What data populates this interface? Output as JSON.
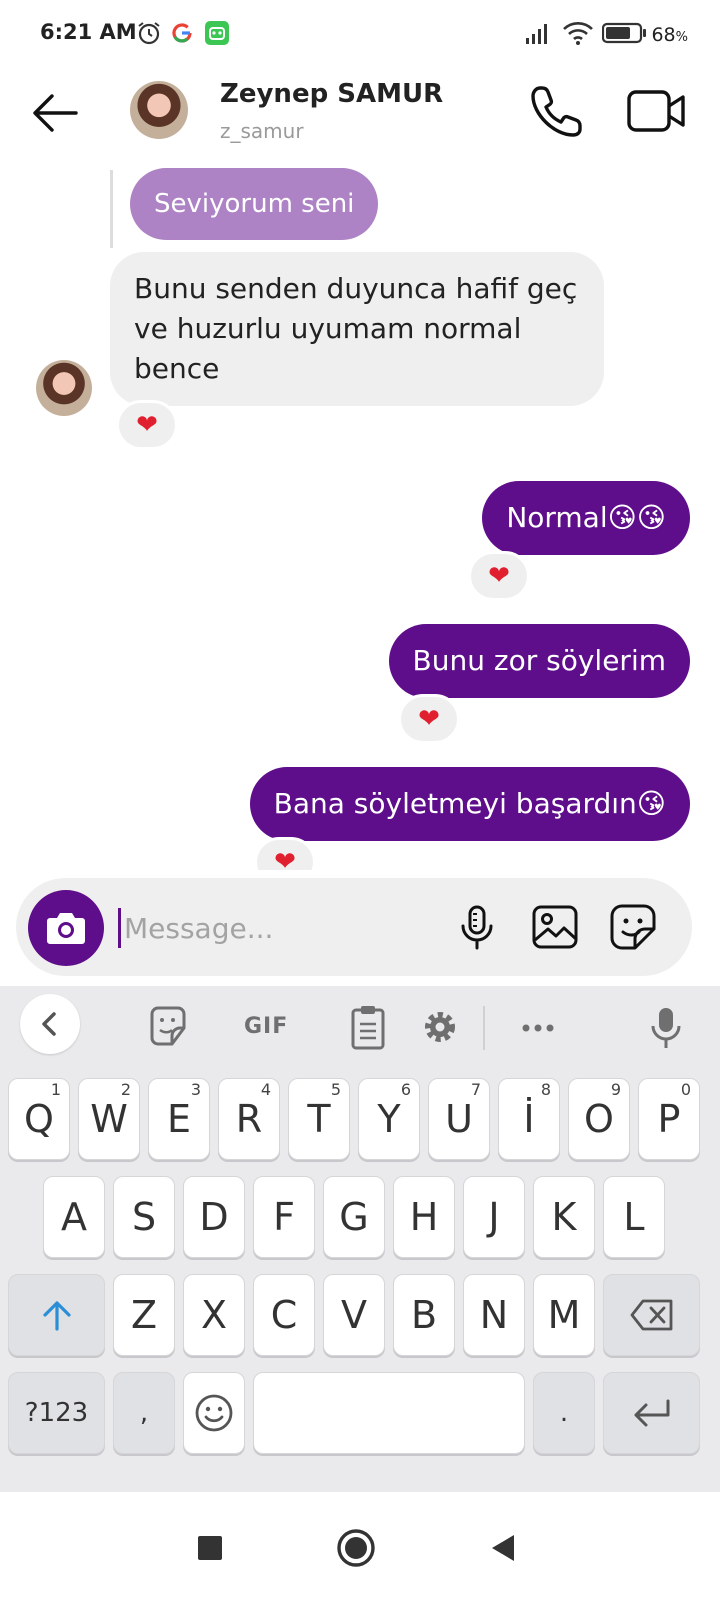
{
  "status_bar": {
    "time": "6:21 AM",
    "battery_percent": "68",
    "battery_suffix": "%",
    "icons": [
      "alarm-icon",
      "google-icon",
      "robot-app-icon",
      "signal-icon",
      "wifi-icon",
      "battery-icon"
    ]
  },
  "header": {
    "contact_name": "Zeynep SAMUR",
    "username": "z_samur",
    "icons": [
      "back-arrow-icon",
      "phone-icon",
      "video-camera-icon"
    ]
  },
  "messages": [
    {
      "type": "quoted",
      "text": "Seviyorum seni"
    },
    {
      "type": "incoming",
      "text": "Bunu senden duyunca hafif geç ve huzurlu uyumam normal bence",
      "reaction": "❤"
    },
    {
      "type": "outgoing",
      "text": "Normal😘😘",
      "reaction": "❤"
    },
    {
      "type": "outgoing",
      "text": "Bunu zor söylerim",
      "reaction": "❤"
    },
    {
      "type": "outgoing",
      "text": "Bana söyletmeyi başardın😘",
      "reaction": "❤"
    }
  ],
  "composer": {
    "placeholder": "Message...",
    "value": "",
    "icons": [
      "camera-icon",
      "microphone-icon",
      "gallery-icon",
      "sticker-icon"
    ]
  },
  "keyboard": {
    "toolbar": {
      "gif_label": "GIF",
      "icons": [
        "chevron-left-icon",
        "sticker-icon",
        "clipboard-icon",
        "gear-icon",
        "more-icon",
        "microphone-icon"
      ]
    },
    "row1": [
      {
        "key": "Q",
        "num": "1"
      },
      {
        "key": "W",
        "num": "2"
      },
      {
        "key": "E",
        "num": "3"
      },
      {
        "key": "R",
        "num": "4"
      },
      {
        "key": "T",
        "num": "5"
      },
      {
        "key": "Y",
        "num": "6"
      },
      {
        "key": "U",
        "num": "7"
      },
      {
        "key": "İ",
        "num": "8"
      },
      {
        "key": "O",
        "num": "9"
      },
      {
        "key": "P",
        "num": "0"
      }
    ],
    "row2": [
      "A",
      "S",
      "D",
      "F",
      "G",
      "H",
      "J",
      "K",
      "L"
    ],
    "row3": [
      "Z",
      "X",
      "C",
      "V",
      "B",
      "N",
      "M"
    ],
    "row4": {
      "symbols": "?123",
      "comma": ",",
      "period": "."
    }
  },
  "navbar": {
    "icons": [
      "recents-square-icon",
      "home-circle-icon",
      "back-triangle-icon"
    ]
  },
  "colors": {
    "accent": "#5e0d8b",
    "quoted": "#ad83c5",
    "incoming": "#efefef",
    "heart": "#e0202e"
  }
}
